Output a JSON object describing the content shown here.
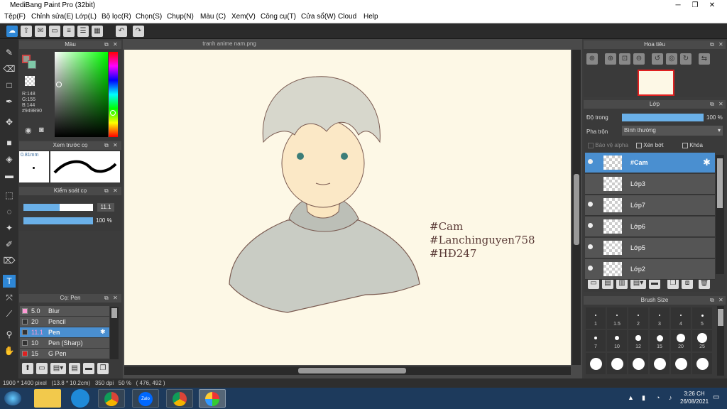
{
  "window": {
    "title": "MediBang Paint Pro (32bit)"
  },
  "menu": [
    "Tệp(F)",
    "Chỉnh sửa(E)",
    "Lớp(L)",
    "Bộ lọc(R)",
    "Chọn(S)",
    "Chụp(N)",
    "Màu (C)",
    "Xem(V)",
    "Công cụ(T)",
    "Cửa sổ(W)",
    "Cloud",
    "Help"
  ],
  "color_panel": {
    "title": "Màu",
    "r": "R:148",
    "g": "G:155",
    "b": "B:144",
    "hex": "#949B90",
    "fg": "#949B90",
    "bg": "#7fc8a8"
  },
  "preview_panel": {
    "title": "Xem trước cọ",
    "size": "0.81mm"
  },
  "brush_control": {
    "title": "Kiểm soát cọ",
    "size_value": "11.1",
    "size_fraction": 0.52,
    "opacity_value": "100 %",
    "opacity_fraction": 1.0
  },
  "brush_panel": {
    "title": "Cọ: Pen",
    "items": [
      {
        "size": "5.0",
        "name": "Blur",
        "color": "#ff9ad5",
        "selected": false
      },
      {
        "size": "20",
        "name": "Pencil",
        "color": "#333333",
        "selected": false
      },
      {
        "size": "11.1",
        "name": "Pen",
        "color": "#333333",
        "selected": true
      },
      {
        "size": "10",
        "name": "Pen (Sharp)",
        "color": "#333333",
        "selected": false
      },
      {
        "size": "15",
        "name": "G Pen",
        "color": "#e02020",
        "selected": false
      }
    ]
  },
  "document": {
    "tab": "tranh anime nam.png",
    "hashtags": [
      "#Cam",
      "#Lanchinguyen758",
      "#HĐ247"
    ]
  },
  "navigator": {
    "title": "Hoa tiêu"
  },
  "layer_panel": {
    "title": "Lớp",
    "opacity_label": "Độ trong",
    "opacity_value": "100 %",
    "opacity_fraction": 1.0,
    "blend_label": "Pha trộn",
    "blend_value": "Bình thường",
    "protect_alpha": "Bảo vệ alpha",
    "clip": "Xén bớt",
    "lock": "Khóa",
    "layers": [
      {
        "name": "#Cam",
        "selected": true,
        "visible": true
      },
      {
        "name": "Lớp3",
        "selected": false,
        "visible": false
      },
      {
        "name": "Lớp7",
        "selected": false,
        "visible": true
      },
      {
        "name": "Lớp6",
        "selected": false,
        "visible": true
      },
      {
        "name": "Lớp5",
        "selected": false,
        "visible": true
      },
      {
        "name": "Lớp2",
        "selected": false,
        "visible": true
      }
    ]
  },
  "brush_size_panel": {
    "title": "Brush Size",
    "labels": [
      "1",
      "1.5",
      "2",
      "3",
      "4",
      "5",
      "7",
      "10",
      "12",
      "15",
      "20",
      "25"
    ]
  },
  "status": {
    "text": "1900 * 1400 pixel   (13.8 * 10.2cm)   350 dpi   50 %   ( 476, 492 )"
  },
  "taskbar": {
    "time": "3:26 CH",
    "date": "26/08/2021",
    "zalo": "Zalo"
  }
}
